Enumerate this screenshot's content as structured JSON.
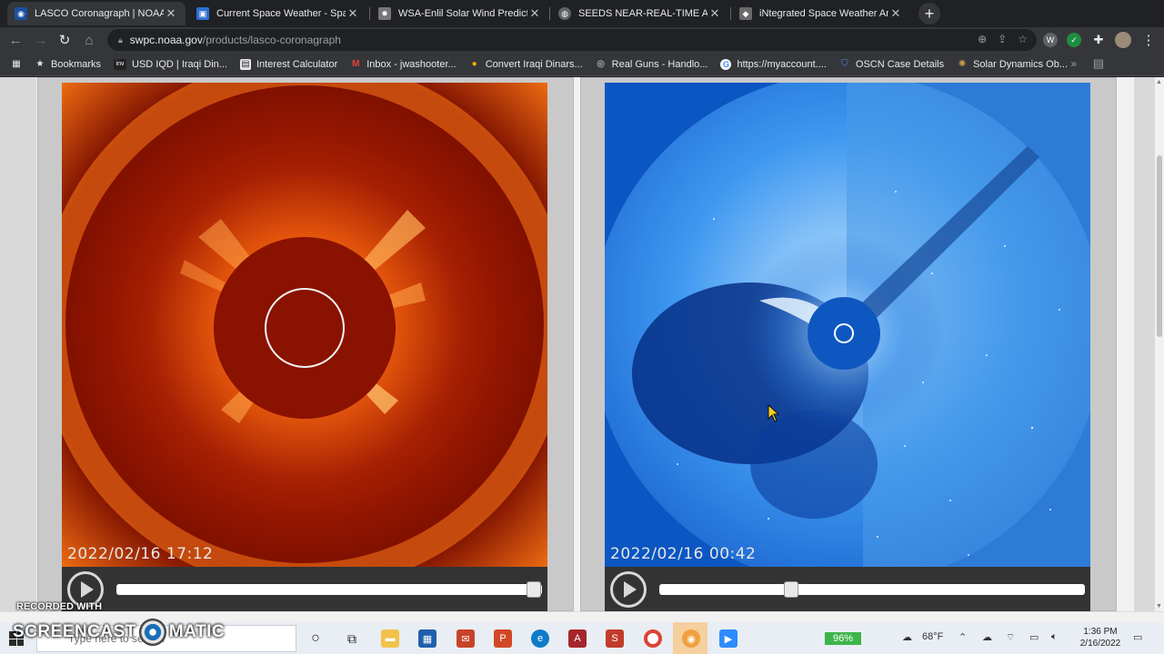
{
  "tabs": [
    {
      "title": "LASCO Coronagraph | NOAA / NWS",
      "active": true,
      "icon": "noaa-icon",
      "color": "#1b4f9c"
    },
    {
      "title": "Current Space Weather - Space Weather",
      "active": false,
      "icon": "page-icon",
      "color": "#2e6fd0"
    },
    {
      "title": "WSA-Enlil Solar Wind Prediction",
      "active": false,
      "icon": "enlil-icon",
      "color": "#777777"
    },
    {
      "title": "SEEDS NEAR-REAL-TIME AND BEYOND",
      "active": false,
      "icon": "globe-icon",
      "color": "#5f6368"
    },
    {
      "title": "iNtegrated Space Weather Analysis",
      "active": false,
      "icon": "iswa-icon",
      "color": "#6a6a6a"
    }
  ],
  "address": {
    "host": "swpc.noaa.gov",
    "path": "/products/lasco-coronagraph"
  },
  "bookmarks": [
    {
      "label": "Bookmarks",
      "icon": "star-icon"
    },
    {
      "label": "USD IQD | Iraqi Din...",
      "icon": "inv-icon"
    },
    {
      "label": "Interest Calculator",
      "icon": "calculator-icon"
    },
    {
      "label": "Inbox - jwashooter...",
      "icon": "gmail-icon"
    },
    {
      "label": "Convert Iraqi Dinars...",
      "icon": "coins-icon"
    },
    {
      "label": "Real Guns - Handlo...",
      "icon": "target-icon"
    },
    {
      "label": "https://myaccount....",
      "icon": "google-icon"
    },
    {
      "label": "OSCN Case Details",
      "icon": "shield-icon"
    },
    {
      "label": "Solar Dynamics Ob...",
      "icon": "sdo-icon"
    }
  ],
  "bookmarks_more": "»",
  "coronagraphs": [
    {
      "timestamp": "2022/02/16  17:12",
      "slider_position": 0.98
    },
    {
      "timestamp": "2022/02/16  00:42",
      "slider_position": 0.31
    }
  ],
  "taskbar": {
    "search_placeholder": "Type here to search",
    "battery": "96%",
    "weather": "68°F",
    "time": "1:36 PM",
    "date": "2/16/2022"
  },
  "watermark": {
    "line1": "RECORDED WITH",
    "line2a": "SCREENCAST",
    "line2b": "MATIC"
  }
}
